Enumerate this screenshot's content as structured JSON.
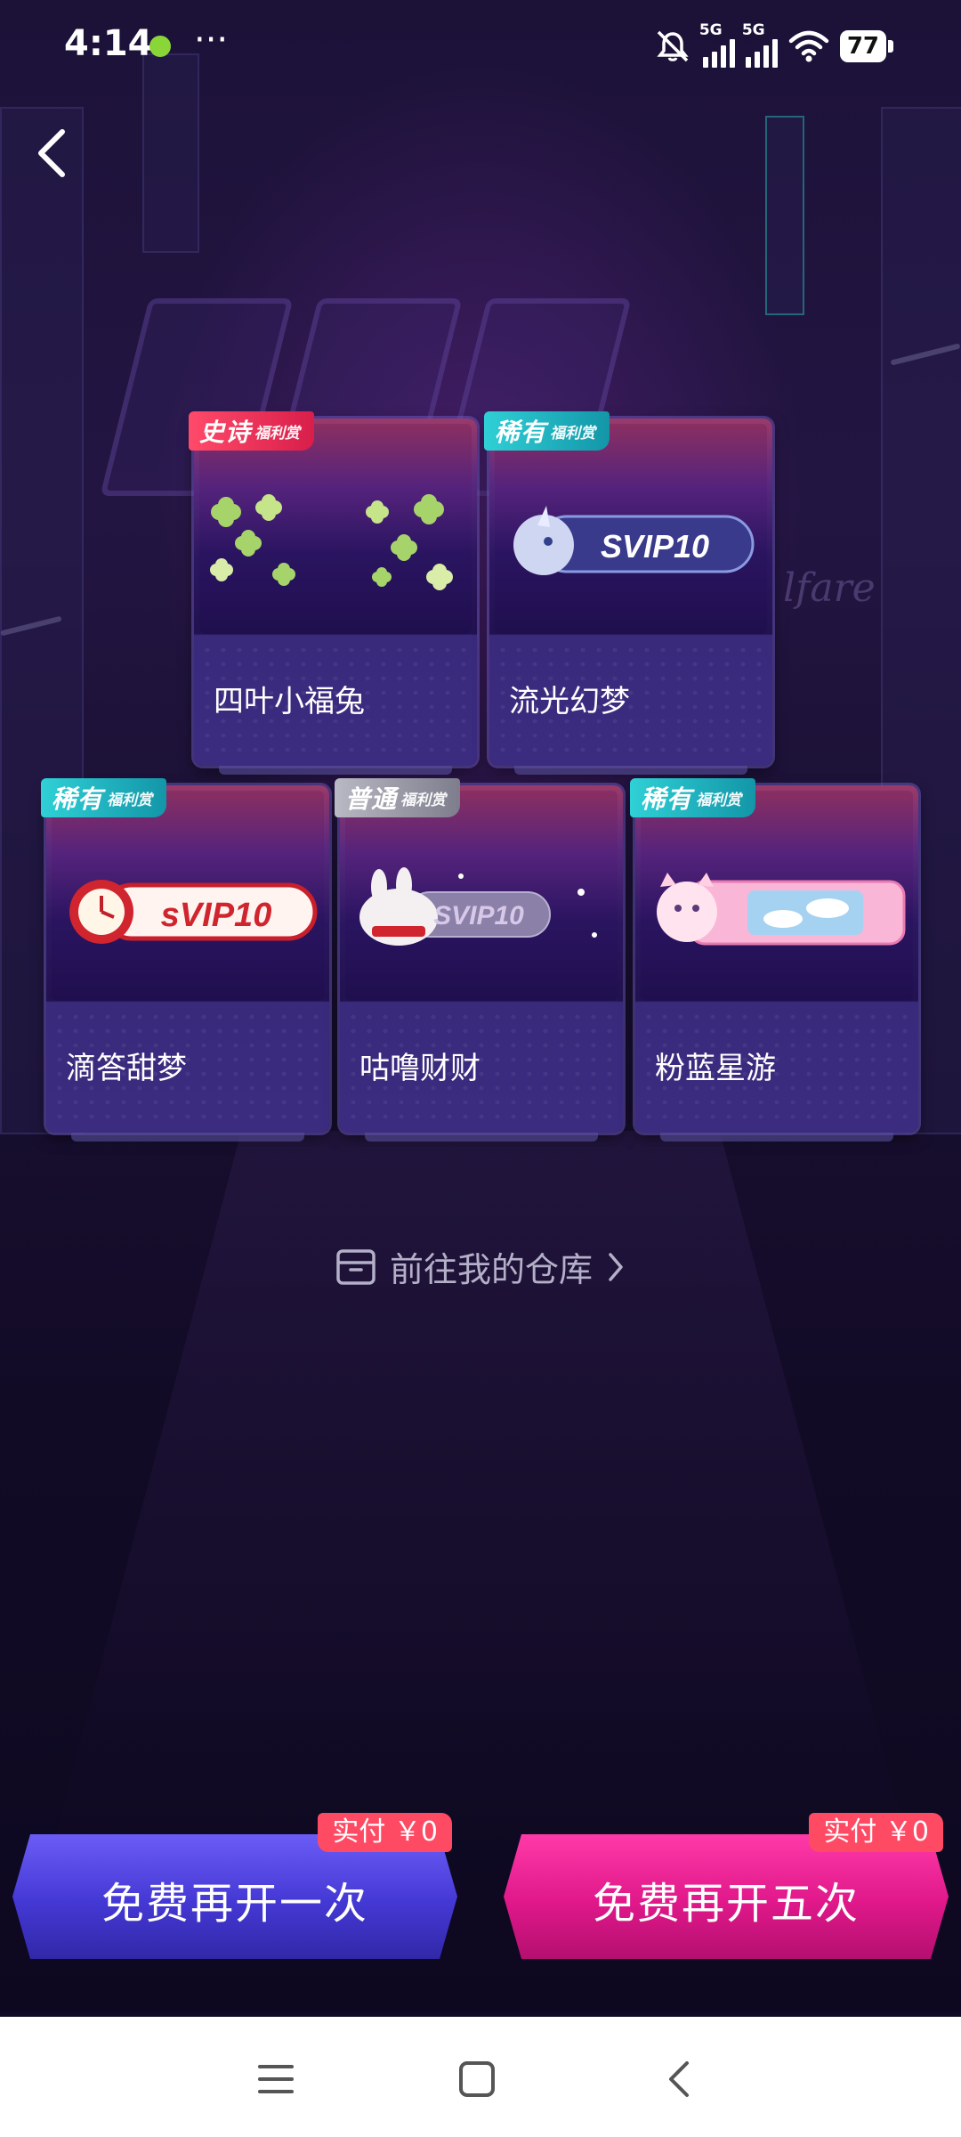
{
  "status_bar": {
    "time": "4:14",
    "more": "···",
    "signal1_label": "5G",
    "signal2_label": "5G",
    "battery": "77"
  },
  "cards": [
    {
      "badge_tier": "史诗",
      "badge_sub": "福利赏",
      "badge_color": "#ff3b5c",
      "name": "四叶小福兔",
      "art_icon": "four-leaf-clover"
    },
    {
      "badge_tier": "稀有",
      "badge_sub": "福利赏",
      "badge_color": "#1fb8c4",
      "name": "流光幻梦",
      "art_icon": "unicorn-svip-badge",
      "art_text": "SVIP10"
    },
    {
      "badge_tier": "稀有",
      "badge_sub": "福利赏",
      "badge_color": "#1fb8c4",
      "name": "滴答甜梦",
      "art_icon": "clock-svip-badge",
      "art_text": "sVIP10"
    },
    {
      "badge_tier": "普通",
      "badge_sub": "福利赏",
      "badge_color": "#9a9aa8",
      "name": "咕噜财财",
      "art_icon": "bunny-svip-badge",
      "art_text": "SVIP10"
    },
    {
      "badge_tier": "稀有",
      "badge_sub": "福利赏",
      "badge_color": "#1fb8c4",
      "name": "粉蓝星游",
      "art_icon": "game-console-badge"
    }
  ],
  "warehouse_link": "前往我的仓库",
  "buttons": {
    "open_once": "免费再开一次",
    "open_five": "免费再开五次",
    "price_once": "实付 ￥0",
    "price_five": "实付 ￥0"
  },
  "colors": {
    "open_once_btn": "#4a3ee0",
    "open_five_btn": "#e01a8a",
    "price_tag": "#ff4a64"
  }
}
